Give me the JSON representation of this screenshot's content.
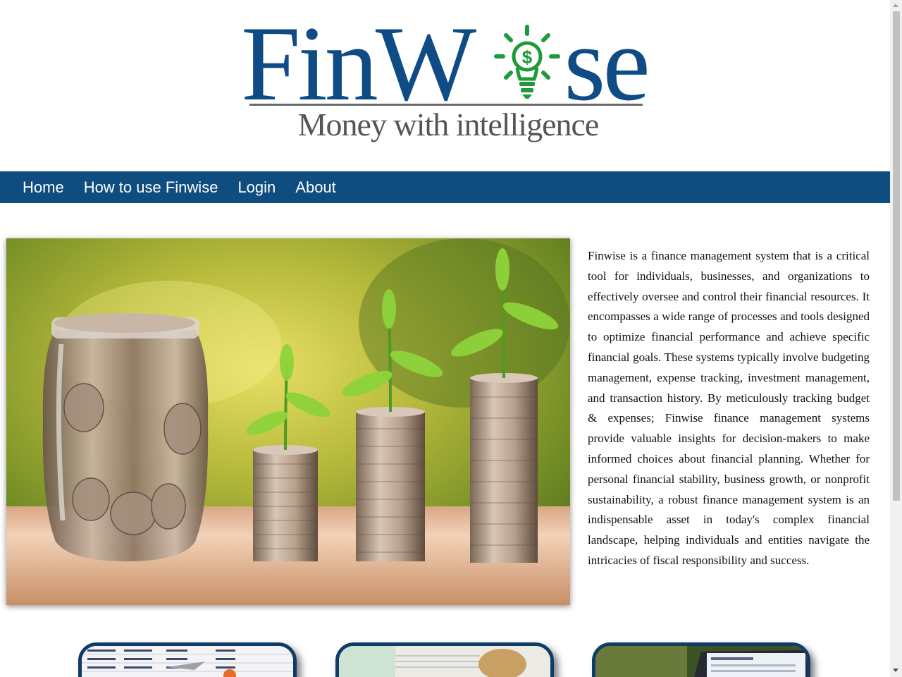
{
  "logo": {
    "word_left": "FinW",
    "word_right": "se",
    "tagline": "Money with intelligence"
  },
  "nav": {
    "items": [
      {
        "label": "Home"
      },
      {
        "label": "How to use Finwise"
      },
      {
        "label": "Login"
      },
      {
        "label": "About"
      }
    ]
  },
  "hero": {
    "icon": "coin-jar-growth-photo"
  },
  "description": "Finwise is a finance management system that is a critical tool for individuals, businesses, and organizations to effectively oversee and control their financial resources. It encompasses a wide range of processes and tools designed to optimize financial performance and achieve specific financial goals. These systems typically involve budgeting management, expense tracking, investment management, and transaction history. By meticulously tracking budget & expenses; Finwise finance management systems provide valuable insights for decision-makers to make informed choices about financial planning. Whether for personal financial stability, business growth, or nonprofit sustainability, a robust finance management system is an indispensable asset in today's complex financial landscape, helping individuals and entities navigate the intricacies of fiscal responsibility and success.",
  "colors": {
    "brand_blue": "#0f4c86",
    "nav_bg": "#0f4c7f",
    "bulb_green": "#1e9a3a",
    "card_border": "#0f3c66"
  },
  "cards": [
    {
      "icon": "spreadsheet-photo"
    },
    {
      "icon": "cash-potato-photo"
    },
    {
      "icon": "laptop-dashboard-photo"
    }
  ]
}
